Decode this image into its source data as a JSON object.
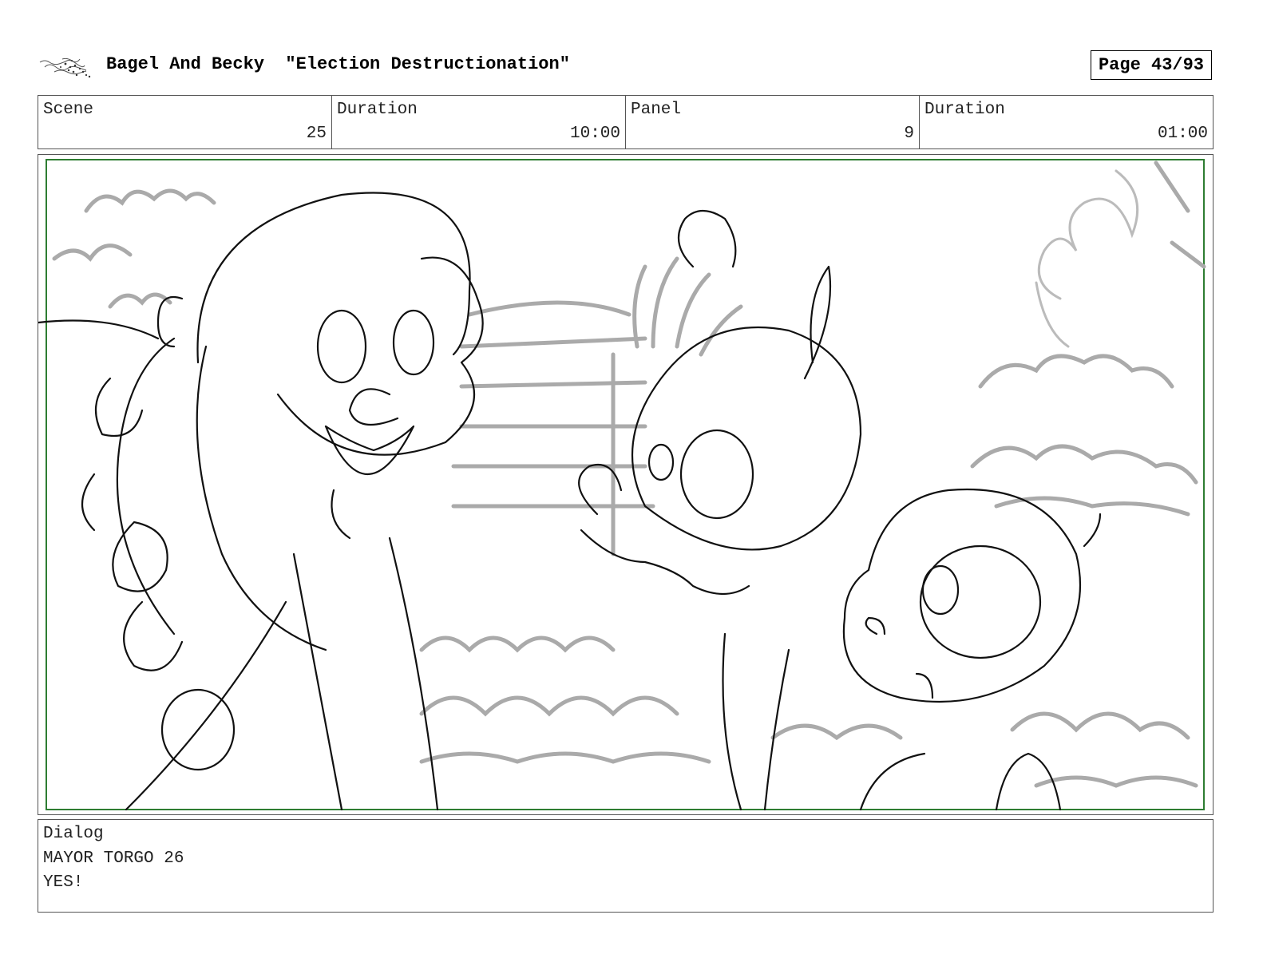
{
  "header": {
    "logo_icon": "scribble-logo-icon",
    "title": "Bagel And Becky  \"Election Destructionation\"",
    "page": "Page 43/93"
  },
  "meta": {
    "scene_label": "Scene",
    "scene_value": "25",
    "duration_label": "Duration",
    "duration_value": "10:00",
    "panel_label": "Panel",
    "panel_value": "9",
    "panel_duration_label": "Duration",
    "panel_duration_value": "01:00"
  },
  "panel": {
    "frame_color": "#2e7d32"
  },
  "dialog": {
    "label": "Dialog",
    "speaker": "MAYOR TORGO 26",
    "line": "YES!"
  }
}
